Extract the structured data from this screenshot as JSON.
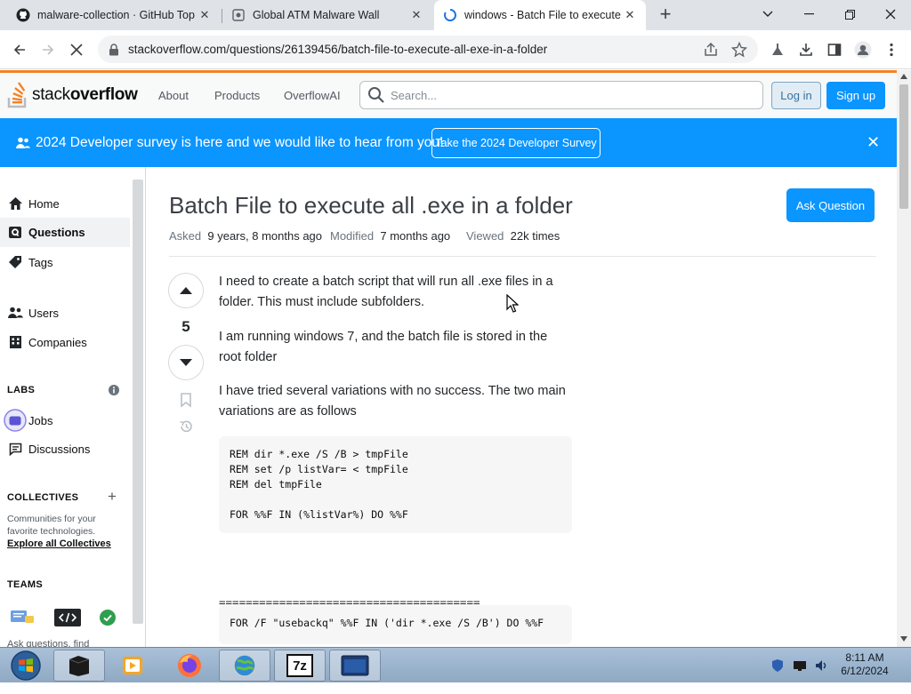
{
  "browser": {
    "tabs": [
      {
        "title": "malware-collection · GitHub Top"
      },
      {
        "title": "Global ATM Malware Wall"
      },
      {
        "title": "windows - Batch File to execute"
      }
    ],
    "new_tab": "+",
    "url": "stackoverflow.com/questions/26139456/batch-file-to-execute-all-exe-in-a-folder"
  },
  "so_header": {
    "logo_light": "stack",
    "logo_bold": "overflow",
    "nav": [
      "About",
      "Products",
      "OverflowAI"
    ],
    "search_placeholder": "Search...",
    "login": "Log in",
    "signup": "Sign up"
  },
  "banner": {
    "text": "2024 Developer survey is here and we would like to hear from you!",
    "button": "Take the 2024 Developer Survey",
    "close": "✕"
  },
  "sidebar": {
    "home": "Home",
    "questions": "Questions",
    "tags": "Tags",
    "users": "Users",
    "companies": "Companies",
    "labs_heading": "LABS",
    "jobs": "Jobs",
    "discussions": "Discussions",
    "collectives_heading": "COLLECTIVES",
    "collectives_line1": "Communities for your",
    "collectives_line2": "favorite technologies.",
    "collectives_link": "Explore all Collectives",
    "teams_heading": "TEAMS",
    "teams_text": "Ask questions, find"
  },
  "question": {
    "title": "Batch File to execute all .exe in a folder",
    "ask_button": "Ask Question",
    "asked_label": "Asked",
    "asked_value": "9 years, 8 months ago",
    "modified_label": "Modified",
    "modified_value": "7 months ago",
    "viewed_label": "Viewed",
    "viewed_value": "22k times",
    "votes": "5",
    "para1_line1": "I need to create a batch script that will run all .exe files in a",
    "para1_line2": "folder. This must include subfolders.",
    "para2_line1": "I am running windows 7, and the batch file is stored in the",
    "para2_line2": "root folder",
    "para3_line1": "I have tried several variations with no success. The two main",
    "para3_line2": "variations are as follows",
    "code1": "REM dir *.exe /S /B > tmpFile\nREM set /p listVar= < tmpFile\nREM del tmpFile\n\nFOR %%F IN (%listVar%) DO %%F",
    "eq_line1": "=======================================",
    "eq_line2": "=",
    "code2": "FOR /F \"usebackq\" %%F IN ('dir *.exe /S /B') DO %%F"
  },
  "taskbar": {
    "time": "8:11 AM",
    "date": "6/12/2024",
    "sevenzip_label": "7z"
  }
}
